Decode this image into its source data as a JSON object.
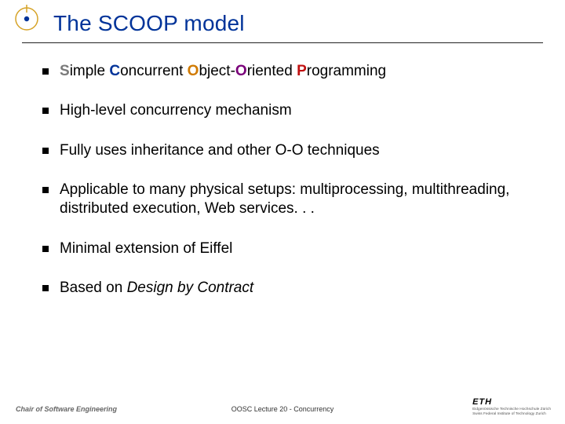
{
  "title": "The SCOOP model",
  "acronym": {
    "s": "S",
    "s_rest": "imple ",
    "c": "C",
    "c_rest": "oncurrent ",
    "o1": "O",
    "o1_rest": "bject",
    "hyphen": "-",
    "o2": "O",
    "o2_rest": "riented ",
    "p": "P",
    "p_rest": "rogramming"
  },
  "bullets": {
    "1": "High-level concurrency mechanism",
    "2": "Fully uses inheritance and other O-O techniques",
    "3": "Applicable to many physical setups: multiprocessing, multithreading, distributed execution, Web services. . .",
    "4": "Minimal extension of Eiffel",
    "5a": "Based on ",
    "5b": "Design by Contract"
  },
  "footer": {
    "left": "Chair of Software Engineering",
    "center": "OOSC  Lecture 20 - Concurrency",
    "eth": "ETH",
    "eth_sub1": "Eidgenössische Technische Hochschule Zürich",
    "eth_sub2": "Swiss Federal Institute of Technology Zurich"
  }
}
